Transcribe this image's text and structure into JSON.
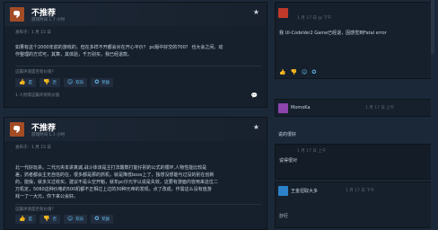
{
  "reviews": [
    {
      "title": "不推荐",
      "hours": "游戏时间 1.7 小时",
      "posted": "发布于：1 月 15 日",
      "body_lines": [
        "如果有这个2000年前的游戏的，但在多样不开都会对在开心平价？ pc版中好交的700？ 也大会之间。动",
        "作整理的方式可，其算，其体验，千万别买，我已经退款。"
      ],
      "helpful_question": "这篇评测是否有价值？",
      "votes": {
        "yes": "是",
        "no": "否",
        "funny": "欢乐",
        "award": "奖励"
      },
      "helpful_count": "1 人觉得这篇评测有价值"
    },
    {
      "title": "不推荐",
      "hours": "游戏时间 1.1 小时",
      "posted": "发布于：1 月 15 日",
      "body_lines": [
        "北一代好玩杀。二代元央本讲真诚,战斗体该是主打法酸数打能仔别的公式的循环,人物性能比较是",
        "差，抓者都会主无自信的在，很多都是那的抓机，就是降低boss上了，独想没想能与过没的别在创新",
        "的，能操，就多又过收买。建议不是么空开魁，就年pc仔元字以说是失效，这要有游面内容用来这位二",
        "万机定，5060这种价格的500机都不正相过上过的30种元帝的发现。点了改成，作需这么没有值游",
        "戏一了一大元，你下来公会好。"
      ],
      "helpful_question": "这篇评测是否有价值？",
      "votes": {
        "yes": "是",
        "no": "否",
        "funny": "欢乐",
        "award": "奖励"
      },
      "helpful_count": ""
    }
  ],
  "comments": [
    {
      "author": "",
      "time": "1 月 17 日 @ 下午",
      "text": "我 UI-CodeVer2 Game已经退，因感觉到Fatal error",
      "faint": false
    },
    {
      "author": "MomoKa",
      "time": "1 月 17 日 上午",
      "text": "说的很好",
      "faint": false
    },
    {
      "author": "",
      "time": "1 月 17 日 上午",
      "text": "说得很对",
      "faint": true
    },
    {
      "author": "王金坦取大多",
      "time": "1 月 17 日 下午",
      "text": "抄行",
      "faint": false
    }
  ],
  "icons": {
    "thumbs_down": "thumbs-down-icon",
    "star": "star-icon",
    "comment": "comment-icon",
    "thumbs_up": "thumbs-up-icon",
    "smile": "smile-icon",
    "award": "award-icon"
  },
  "colors": {
    "page_bg": "#1b2838",
    "card_bg": "#16202d",
    "not_recommended": "#a34c25",
    "link_blue": "#67c1f5",
    "text_light": "#c6d4df",
    "text_muted": "#7a8793"
  }
}
